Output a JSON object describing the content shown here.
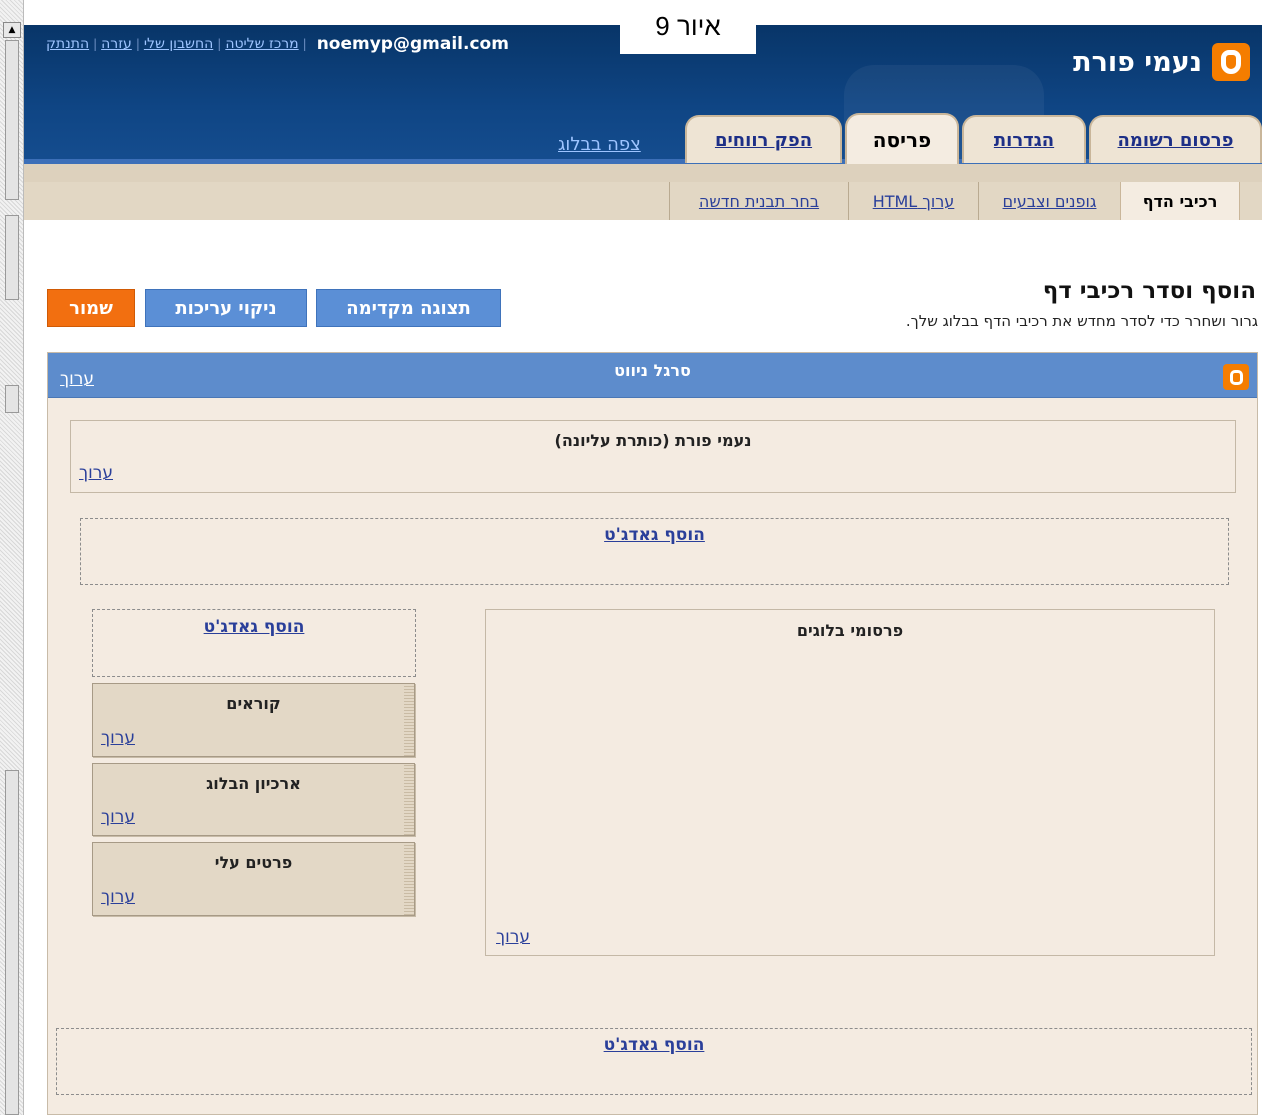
{
  "figure_label": "איור 9",
  "header": {
    "blog_title": "נעמי פורת",
    "email": "noemyp@gmail.com",
    "links": [
      "מרכז שליטה",
      "החשבון שלי",
      "עזרה",
      "התנתק"
    ],
    "view_blog": "צפה בבלוג"
  },
  "tabs": [
    "פרסום רשומה",
    "הגדרות",
    "פריסה",
    "הפק רווחים"
  ],
  "subtabs": [
    "רכיבי הדף",
    "גופנים וצבעים",
    "ערוך HTML",
    "בחר תבנית חדשה"
  ],
  "page": {
    "heading": "הוסף וסדר רכיבי דף",
    "subtitle": "גרור ושחרר כדי לסדר מחדש את רכיבי הדף בבלוג שלך."
  },
  "buttons": {
    "save": "שמור",
    "clear": "ניקוי עריכות",
    "preview": "תצוגה מקדימה"
  },
  "editor": {
    "navbar_title": "סרגל ניווט",
    "header_title": "נעמי פורת (כותרת עליונה)",
    "edit_label": "ערוך",
    "add_gadget": "הוסף גאדג'ט",
    "posts_title": "פרסומי בלוגים",
    "sidebar_gadgets": [
      "קוראים",
      "ארכיון הבלוג",
      "פרטים עלי"
    ]
  },
  "colors": {
    "header_bg": "#0e3d77",
    "accent_orange": "#f26f10",
    "button_blue": "#5b8fd6",
    "tab_bg": "#eee4d4"
  }
}
